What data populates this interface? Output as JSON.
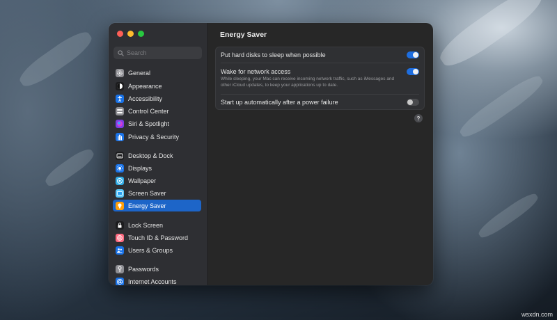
{
  "window": {
    "title": "Energy Saver"
  },
  "search": {
    "placeholder": "Search"
  },
  "sidebar": {
    "items": [
      {
        "label": "General",
        "icon": "gear-icon",
        "color": "#8e8e93"
      },
      {
        "label": "Appearance",
        "icon": "appearance-icon",
        "color": "#1c1c1e"
      },
      {
        "label": "Accessibility",
        "icon": "accessibility-icon",
        "color": "#1a73e8"
      },
      {
        "label": "Control Center",
        "icon": "control-center-icon",
        "color": "#8e8e93"
      },
      {
        "label": "Siri & Spotlight",
        "icon": "siri-icon",
        "color": "#7b3fe4"
      },
      {
        "label": "Privacy & Security",
        "icon": "hand-icon",
        "color": "#1a73e8"
      },
      {
        "label": "Desktop & Dock",
        "icon": "dock-icon",
        "color": "#1c1c1e"
      },
      {
        "label": "Displays",
        "icon": "sun-icon",
        "color": "#1a73e8"
      },
      {
        "label": "Wallpaper",
        "icon": "wallpaper-icon",
        "color": "#32ade6"
      },
      {
        "label": "Screen Saver",
        "icon": "screen-saver-icon",
        "color": "#5ac8fa"
      },
      {
        "label": "Energy Saver",
        "icon": "lightbulb-icon",
        "color": "#ff9f0a",
        "selected": true
      },
      {
        "label": "Lock Screen",
        "icon": "lock-screen-icon",
        "color": "#1c1c1e"
      },
      {
        "label": "Touch ID & Password",
        "icon": "fingerprint-icon",
        "color": "#ff6b81"
      },
      {
        "label": "Users & Groups",
        "icon": "users-icon",
        "color": "#1a73e8"
      },
      {
        "label": "Passwords",
        "icon": "key-icon",
        "color": "#8e8e93"
      },
      {
        "label": "Internet Accounts",
        "icon": "at-icon",
        "color": "#1a73e8"
      }
    ]
  },
  "settings": {
    "hard_disks_label": "Put hard disks to sleep when possible",
    "hard_disks_on": true,
    "wake_label": "Wake for network access",
    "wake_desc": "While sleeping, your Mac can receive incoming network traffic, such as iMessages and other iCloud updates, to keep your applications up to date.",
    "wake_on": true,
    "startup_label": "Start up automatically after a power failure",
    "startup_on": false
  },
  "help": {
    "label": "?"
  },
  "watermark": {
    "text": "wsxdn.com"
  },
  "colors": {
    "accent": "#1e6ee0",
    "selection": "#1d65c8"
  }
}
